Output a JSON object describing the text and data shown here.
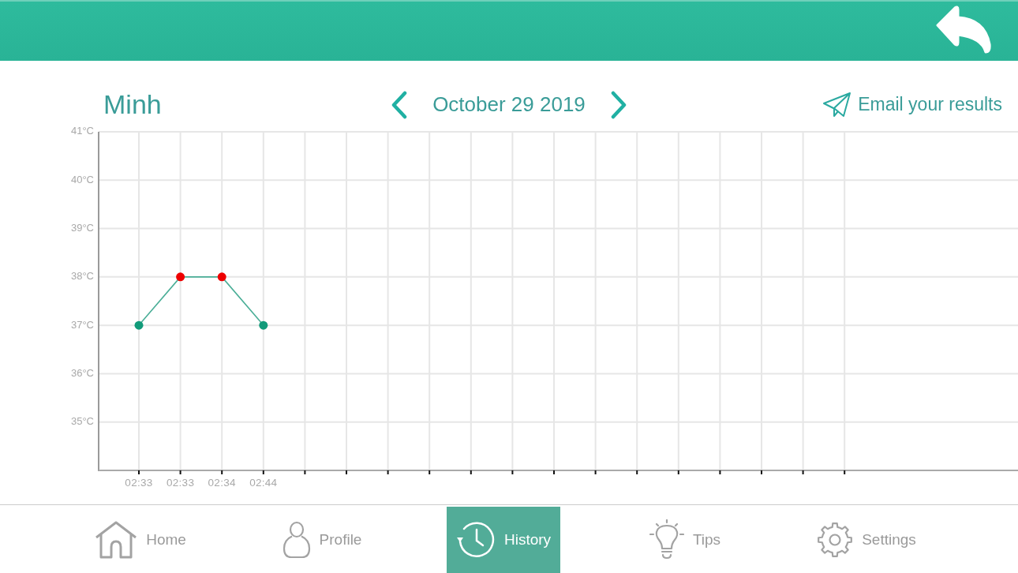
{
  "header": {
    "user_name": "Minh",
    "date": "October 29 2019",
    "email_action": "Email your results"
  },
  "chart": {
    "chart_data": [
      {
        "type": "line",
        "categories": [
          "02:33",
          "02:33",
          "02:34",
          "02:44",
          null,
          null,
          null,
          null,
          null,
          null,
          null,
          null,
          null,
          null,
          null,
          null,
          null,
          null
        ],
        "values": [
          37,
          38,
          38,
          37,
          null,
          null,
          null,
          null,
          null,
          null,
          null,
          null,
          null,
          null,
          null,
          null,
          null,
          null
        ],
        "color": "#4aae97",
        "colors": [
          "#129b7a",
          "#ee0000",
          "#ee0000",
          "#129b7a",
          null,
          null,
          null,
          null,
          null,
          null,
          null,
          null,
          null,
          null,
          null,
          null,
          null,
          null
        ],
        "marker": "circle",
        "ylim": [
          34,
          41
        ],
        "yticks": [
          {
            "value": 35,
            "label": "35°C"
          },
          {
            "value": 36,
            "label": "36°C"
          },
          {
            "value": 37,
            "label": "37°C"
          },
          {
            "value": 38,
            "label": "38°C"
          },
          {
            "value": 39,
            "label": "39°C"
          },
          {
            "value": 40,
            "label": "40°C"
          },
          {
            "value": 41,
            "label": "41°C"
          }
        ],
        "grid": true
      }
    ]
  },
  "nav": [
    {
      "label": "Home",
      "selected": false
    },
    {
      "label": "Profile",
      "selected": false
    },
    {
      "label": "History",
      "selected": true
    },
    {
      "label": "Tips",
      "selected": false
    },
    {
      "label": "Settings",
      "selected": false
    }
  ]
}
